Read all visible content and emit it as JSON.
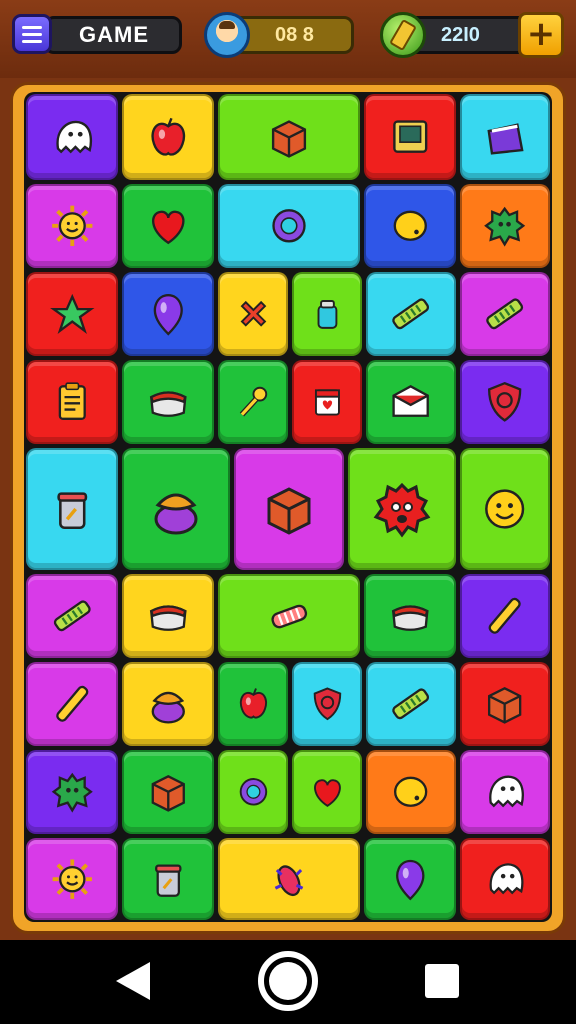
{
  "hud": {
    "game_label": "GAME",
    "score": "08 8",
    "coins": "22I0",
    "plus": "+",
    "menu_icon": "hamburger-icon",
    "avatar_icon": "avatar-icon",
    "coin_icon": "coin-icon"
  },
  "colors": {
    "purple": "#7a2cf0",
    "yellow": "#ffd51e",
    "lime": "#6fe01a",
    "red": "#f0201e",
    "cyan": "#38d8f0",
    "magenta": "#d83ae8",
    "green": "#20c23a",
    "blue": "#2f56e8",
    "orange": "#ff7a18"
  },
  "tiles": [
    {
      "id": "r1c1",
      "color": "purple",
      "icon": "ghost"
    },
    {
      "id": "r1c2",
      "color": "yellow",
      "icon": "apple"
    },
    {
      "id": "r1c3",
      "color": "lime",
      "icon": "box"
    },
    {
      "id": "r1c4",
      "color": "red",
      "icon": "screen"
    },
    {
      "id": "r1c5",
      "color": "cyan",
      "icon": "bag"
    },
    {
      "id": "r2c1",
      "color": "magenta",
      "icon": "sun"
    },
    {
      "id": "r2c2",
      "color": "green",
      "icon": "heart"
    },
    {
      "id": "r2c3",
      "color": "cyan",
      "icon": "orb"
    },
    {
      "id": "r2c4",
      "color": "blue",
      "icon": "egg"
    },
    {
      "id": "r2c5",
      "color": "orange",
      "icon": "splat"
    },
    {
      "id": "r3c1",
      "color": "red",
      "icon": "star"
    },
    {
      "id": "r3c2",
      "color": "blue",
      "icon": "gem"
    },
    {
      "id": "r3c3",
      "color": "yellow",
      "icon": "cross"
    },
    {
      "id": "r3c4",
      "color": "lime",
      "icon": "jar"
    },
    {
      "id": "r3c5",
      "color": "cyan",
      "icon": "bar"
    },
    {
      "id": "r3c6",
      "color": "magenta",
      "icon": "bar"
    },
    {
      "id": "r4c1",
      "color": "red",
      "icon": "clipboard"
    },
    {
      "id": "r4c2",
      "color": "green",
      "icon": "pillow"
    },
    {
      "id": "r4c3",
      "color": "green",
      "icon": "key"
    },
    {
      "id": "r4c4",
      "color": "red",
      "icon": "calendar"
    },
    {
      "id": "r4c5",
      "color": "green",
      "icon": "envelope"
    },
    {
      "id": "r4c6",
      "color": "purple",
      "icon": "shield"
    },
    {
      "id": "r5c1",
      "color": "cyan",
      "icon": "cup"
    },
    {
      "id": "r5c2",
      "color": "green",
      "icon": "pot"
    },
    {
      "id": "r5c3",
      "color": "magenta",
      "icon": "box"
    },
    {
      "id": "r5c4",
      "color": "lime",
      "icon": "monster"
    },
    {
      "id": "r5c5",
      "color": "lime",
      "icon": "smile"
    },
    {
      "id": "r6c1",
      "color": "magenta",
      "icon": "bar"
    },
    {
      "id": "r6c2",
      "color": "yellow",
      "icon": "pillow"
    },
    {
      "id": "r6c3",
      "color": "lime",
      "icon": "candy"
    },
    {
      "id": "r6c4",
      "color": "green",
      "icon": "pillow"
    },
    {
      "id": "r6c5",
      "color": "purple",
      "icon": "pen"
    },
    {
      "id": "r7c1",
      "color": "magenta",
      "icon": "pen"
    },
    {
      "id": "r7c2",
      "color": "yellow",
      "icon": "pot"
    },
    {
      "id": "r7c3",
      "color": "green",
      "icon": "apple"
    },
    {
      "id": "r7c4",
      "color": "cyan",
      "icon": "shield"
    },
    {
      "id": "r7c5",
      "color": "cyan",
      "icon": "bar"
    },
    {
      "id": "r7c6",
      "color": "red",
      "icon": "box"
    },
    {
      "id": "r8c1",
      "color": "purple",
      "icon": "splat"
    },
    {
      "id": "r8c2",
      "color": "green",
      "icon": "box"
    },
    {
      "id": "r8c3",
      "color": "lime",
      "icon": "orb"
    },
    {
      "id": "r8c4",
      "color": "lime",
      "icon": "heart"
    },
    {
      "id": "r8c5",
      "color": "orange",
      "icon": "egg"
    },
    {
      "id": "r8c6",
      "color": "magenta",
      "icon": "ghost"
    },
    {
      "id": "r9c1",
      "color": "magenta",
      "icon": "sun"
    },
    {
      "id": "r9c2",
      "color": "green",
      "icon": "cup"
    },
    {
      "id": "r9c3",
      "color": "yellow",
      "icon": "bug"
    },
    {
      "id": "r9c4",
      "color": "green",
      "icon": "gem"
    },
    {
      "id": "r9c5",
      "color": "red",
      "icon": "ghost"
    }
  ],
  "nav": {
    "back_icon": "back-icon",
    "home_icon": "home-icon",
    "recent_icon": "recent-apps-icon"
  }
}
